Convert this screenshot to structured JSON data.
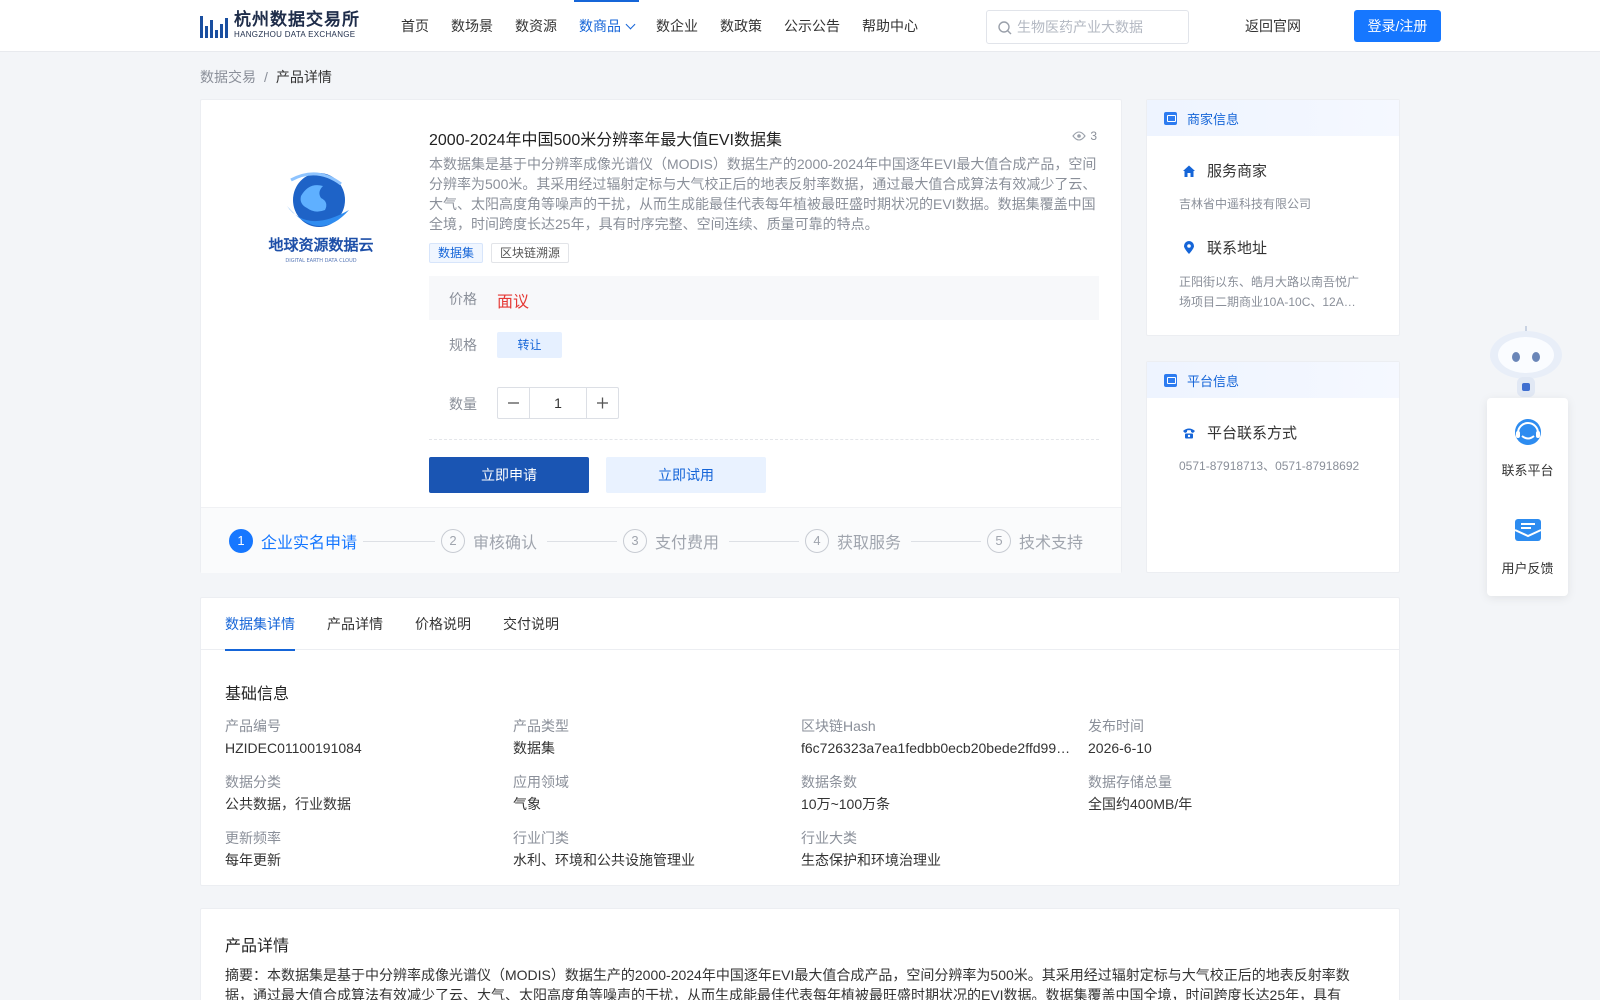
{
  "header": {
    "logo_cn": "杭州数据交易所",
    "logo_en": "HANGZHOU DATA EXCHANGE",
    "nav": [
      {
        "label": "首页"
      },
      {
        "label": "数场景"
      },
      {
        "label": "数资源"
      },
      {
        "label": "数商品"
      },
      {
        "label": "数企业"
      },
      {
        "label": "数政策"
      },
      {
        "label": "公示公告"
      },
      {
        "label": "帮助中心"
      }
    ],
    "active_nav": "数商品",
    "search_placeholder": "生物医药产业大数据",
    "back_link": "返回官网",
    "login_label": "登录/注册"
  },
  "breadcrumb": {
    "root": "数据交易",
    "separator": "/",
    "current": "产品详情"
  },
  "product": {
    "title": "2000-2024年中国500米分辨率年最大值EVI数据集",
    "views": "3",
    "description": "本数据集是基于中分辨率成像光谱仪（MODIS）数据生产的2000-2024年中国逐年EVI最大值合成产品，空间分辨率为500米。其采用经过辐射定标与大气校正后的地表反射率数据，通过最大值合成算法有效减少了云、大气、太阳高度角等噪声的干扰，从而生成能最佳代表每年植被最旺盛时期状况的EVI数据。数据集覆盖中国全境，时间跨度长达25年，具有时序完整、空间连续、质量可靠的特点。",
    "tags": [
      "数据集",
      "区块链溯源"
    ],
    "price_label": "价格",
    "price_value": "面议",
    "spec_label": "规格",
    "spec_option": "转让",
    "qty_label": "数量",
    "qty_value": "1",
    "apply_label": "立即申请",
    "trial_label": "立即试用",
    "logo_text": "地球资源数据云",
    "logo_sub": "DIGITAL  EARTH  DATA  CLOUD"
  },
  "steps": [
    {
      "num": "1",
      "label": "企业实名申请"
    },
    {
      "num": "2",
      "label": "审核确认"
    },
    {
      "num": "3",
      "label": "支付费用"
    },
    {
      "num": "4",
      "label": "获取服务"
    },
    {
      "num": "5",
      "label": "技术支持"
    }
  ],
  "merchant": {
    "header": "商家信息",
    "service_title": "服务商家",
    "service_value": "吉林省中遥科技有限公司",
    "address_title": "联系地址",
    "address_value": "正阳街以东、皓月大路以南吾悦广场项目二期商业10A-10C、12A…"
  },
  "platform": {
    "header": "平台信息",
    "contact_title": "平台联系方式",
    "contact_value": "0571-87918713、0571-87918692"
  },
  "floating": {
    "contact_label": "联系平台",
    "feedback_label": "用户反馈"
  },
  "tabs": [
    "数据集详情",
    "产品详情",
    "价格说明",
    "交付说明"
  ],
  "basic_info": {
    "title": "基础信息",
    "fields": [
      {
        "label": "产品编号",
        "value": "HZIDEC01100191084"
      },
      {
        "label": "产品类型",
        "value": "数据集"
      },
      {
        "label": "区块链Hash",
        "value": "f6c726323a7ea1fedbb0ecb20bede2ffd991…"
      },
      {
        "label": "发布时间",
        "value": "2026-6-10"
      },
      {
        "label": "数据分类",
        "value": "公共数据，行业数据"
      },
      {
        "label": "应用领域",
        "value": "气象"
      },
      {
        "label": "数据条数",
        "value": "10万~100万条"
      },
      {
        "label": "数据存储总量",
        "value": "全国约400MB/年"
      },
      {
        "label": "更新频率",
        "value": "每年更新"
      },
      {
        "label": "行业门类",
        "value": "水利、环境和公共设施管理业"
      },
      {
        "label": "行业大类",
        "value": "生态保护和环境治理业"
      }
    ]
  },
  "detail": {
    "title": "产品详情",
    "text": "摘要：本数据集是基于中分辨率成像光谱仪（MODIS）数据生产的2000-2024年中国逐年EVI最大值合成产品，空间分辨率为500米。其采用经过辐射定标与大气校正后的地表反射率数据，通过最大值合成算法有效减少了云、大气、太阳高度角等噪声的干扰，从而生成能最佳代表每年植被最旺盛时期状况的EVI数据。数据集覆盖中国全境，时间跨度长达25年，具有时序完整、空间连续、质量可靠的特点。"
  },
  "colors": {
    "primary": "#1677ff",
    "primary_dark": "#1a55b3",
    "price_red": "#e53935"
  }
}
